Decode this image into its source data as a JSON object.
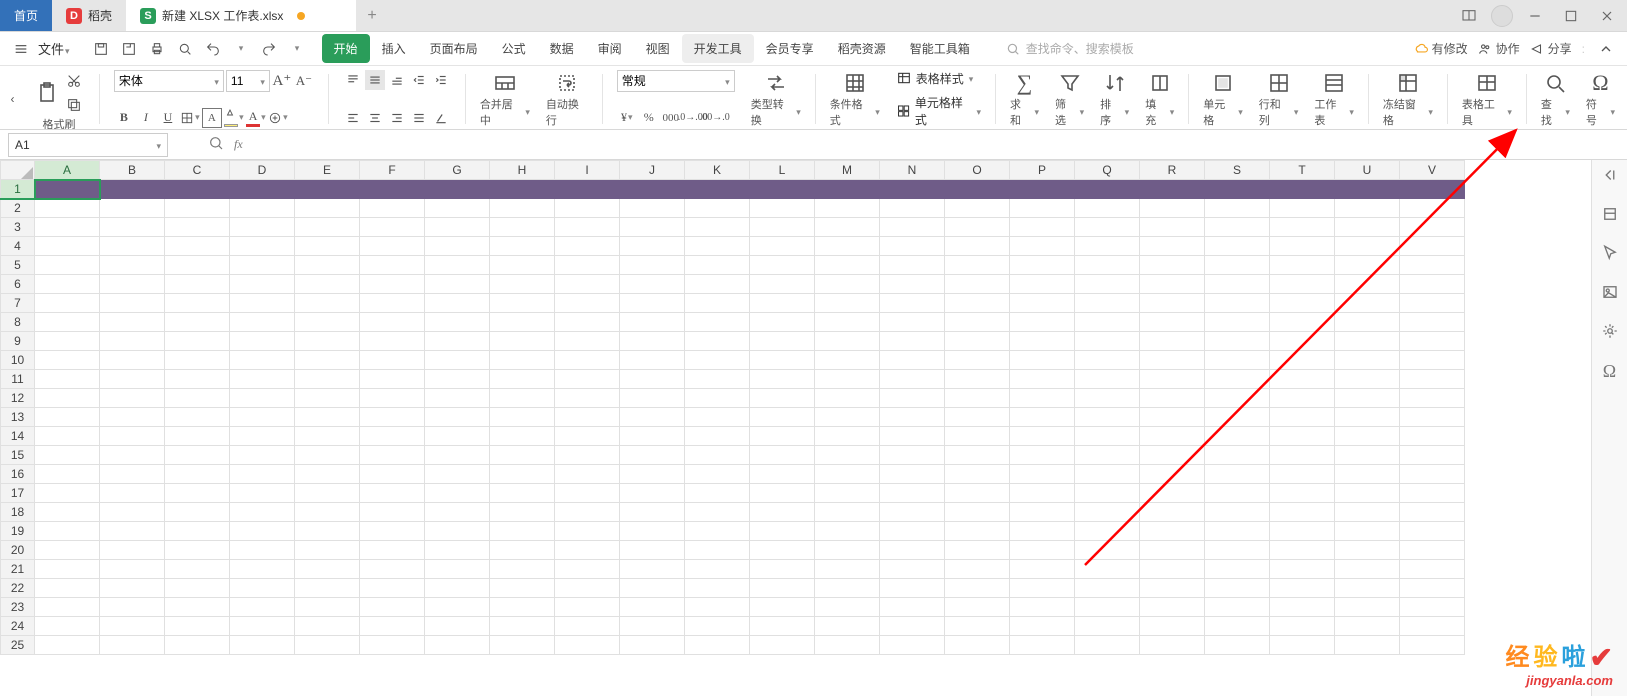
{
  "titlebar": {
    "home": "首页",
    "docke": "稻壳",
    "filetab": "新建 XLSX 工作表.xlsx"
  },
  "menubar": {
    "file": "文件",
    "tabs": [
      "开始",
      "插入",
      "页面布局",
      "公式",
      "数据",
      "审阅",
      "视图",
      "开发工具",
      "会员专享",
      "稻壳资源",
      "智能工具箱"
    ],
    "active_tab": 0,
    "highlight_tab": 7,
    "search_placeholder": "查找命令、搜索模板",
    "right": {
      "changes": "有修改",
      "coop": "协作",
      "share": "分享"
    }
  },
  "ribbon": {
    "format_painter": "格式刷",
    "font_name": "宋体",
    "font_size": "11",
    "merge": "合并居中",
    "wrap": "自动换行",
    "numfmt": "常规",
    "typeconv": "类型转换",
    "cond": "条件格式",
    "tablestyle": "表格样式",
    "cellstyle": "单元格样式",
    "sum": "求和",
    "filter": "筛选",
    "sort": "排序",
    "fill": "填充",
    "cell": "单元格",
    "rowcol": "行和列",
    "sheet": "工作表",
    "freeze": "冻结窗格",
    "tabletool": "表格工具",
    "find": "查找",
    "symbol": "符号"
  },
  "namebox": "A1",
  "columns": [
    "A",
    "B",
    "C",
    "D",
    "E",
    "F",
    "G",
    "H",
    "I",
    "J",
    "K",
    "L",
    "M",
    "N",
    "O",
    "P",
    "Q",
    "R",
    "S",
    "T",
    "U",
    "V"
  ],
  "rowcount": 25,
  "watermark": {
    "cn": "经验啦",
    "url": "jingyanla.com"
  }
}
